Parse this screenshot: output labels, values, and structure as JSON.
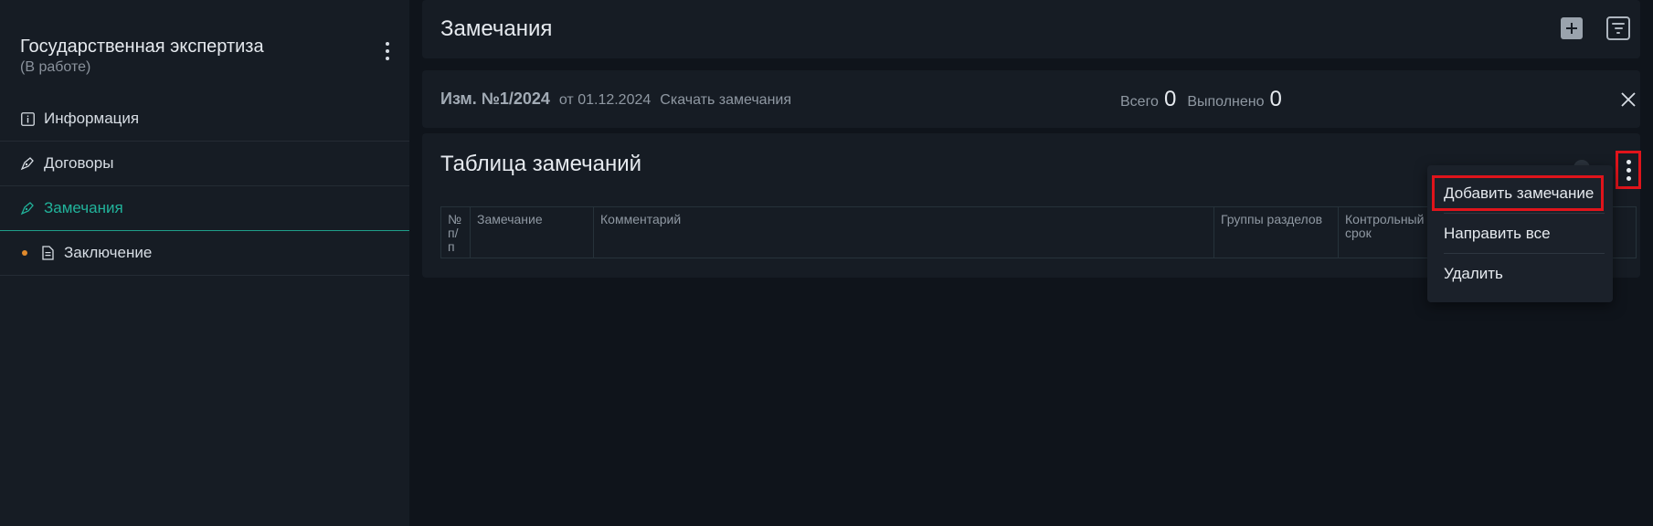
{
  "sidebar": {
    "title": "Государственная экспертиза",
    "status": "(В работе)",
    "items": [
      {
        "label": "Информация",
        "icon": "info-icon"
      },
      {
        "label": "Договоры",
        "icon": "pen-icon"
      },
      {
        "label": "Замечания",
        "icon": "pen-icon",
        "active": true
      },
      {
        "label": "Заключение",
        "icon": "document-icon",
        "marker": "orange-dot"
      }
    ]
  },
  "header": {
    "title": "Замечания"
  },
  "revision": {
    "name": "Изм. №1/2024",
    "date": "от 01.12.2024",
    "download": "Скачать замечания",
    "total_label": "Всего",
    "total_value": "0",
    "done_label": "Выполнено",
    "done_value": "0"
  },
  "table": {
    "title": "Таблица замечаний",
    "columns": [
      "№ п/п",
      "Замечание",
      "Комментарий",
      "Группы разделов",
      "Контрольный срок"
    ]
  },
  "menu": {
    "items": [
      "Добавить замечание",
      "Направить все",
      "Удалить"
    ]
  },
  "colors": {
    "accent": "#21b39b",
    "highlight": "#e0141b",
    "marker": "#e08a2c"
  }
}
